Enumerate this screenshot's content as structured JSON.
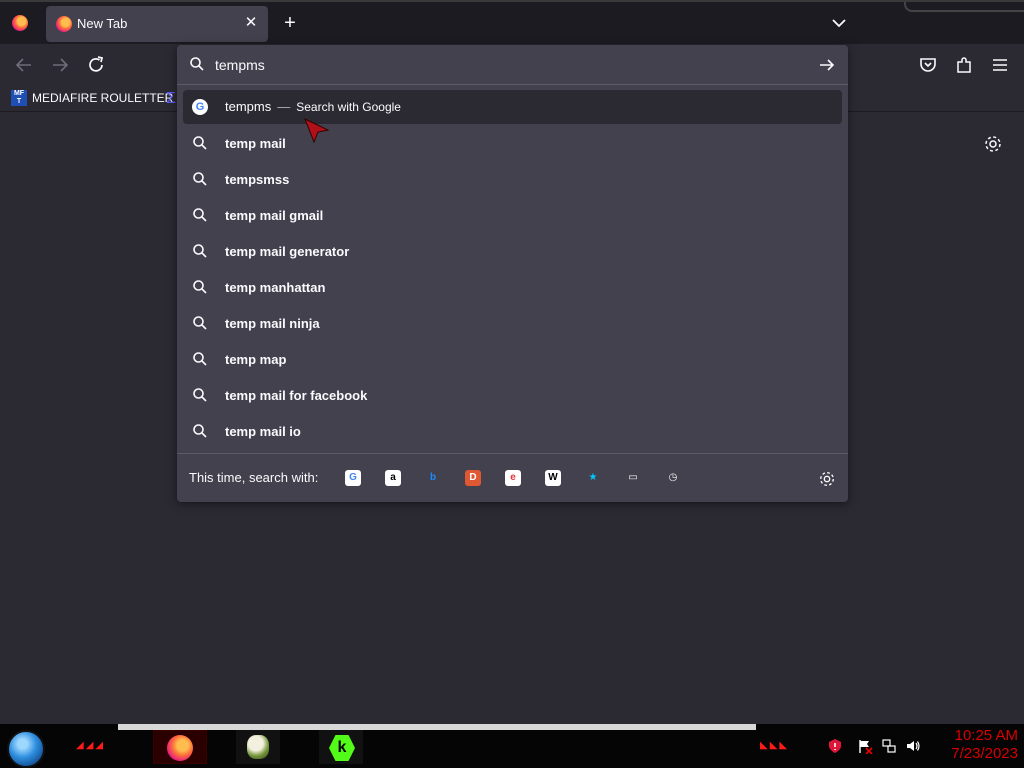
{
  "browser": {
    "tab": {
      "title": "New Tab",
      "close_glyph": "✕"
    },
    "new_tab_glyph": "+",
    "bookmarks": [
      {
        "icon_text": "MF\nT",
        "label": "MEDIAFIRE ROULETTER"
      }
    ]
  },
  "urlbar": {
    "value": "tempms",
    "results": [
      {
        "type": "search-action",
        "query": "tempms",
        "separator": "—",
        "action": "Search with Google",
        "icon": "google-icon",
        "selected": true
      },
      {
        "type": "suggestion",
        "text": "temp mail",
        "icon": "search-icon"
      },
      {
        "type": "suggestion",
        "text": "tempsmss",
        "icon": "search-icon"
      },
      {
        "type": "suggestion",
        "text": "temp mail gmail",
        "icon": "search-icon"
      },
      {
        "type": "suggestion",
        "text": "temp mail generator",
        "icon": "search-icon"
      },
      {
        "type": "suggestion",
        "text": "temp manhattan",
        "icon": "search-icon"
      },
      {
        "type": "suggestion",
        "text": "temp mail ninja",
        "icon": "search-icon"
      },
      {
        "type": "suggestion",
        "text": "temp map",
        "icon": "search-icon"
      },
      {
        "type": "suggestion",
        "text": "temp mail for facebook",
        "icon": "search-icon"
      },
      {
        "type": "suggestion",
        "text": "temp mail io",
        "icon": "search-icon"
      }
    ],
    "footer": {
      "label": "This time, search with:",
      "engines": [
        {
          "name": "google-icon",
          "glyph": "G",
          "color": "#4285f4",
          "bg": "#ffffff"
        },
        {
          "name": "amazon-icon",
          "glyph": "a",
          "color": "#000000",
          "bg": "#ffffff"
        },
        {
          "name": "bing-icon",
          "glyph": "b",
          "color": "#1a8cff",
          "bg": "transparent"
        },
        {
          "name": "duckduckgo-icon",
          "glyph": "D",
          "color": "#ffffff",
          "bg": "#de5833"
        },
        {
          "name": "ebay-icon",
          "glyph": "e",
          "color": "#e53238",
          "bg": "#ffffff"
        },
        {
          "name": "wikipedia-icon",
          "glyph": "W",
          "color": "#000000",
          "bg": "#ffffff"
        },
        {
          "name": "bookmarks-star-icon",
          "glyph": "★",
          "color": "#00c8ff",
          "bg": "transparent"
        },
        {
          "name": "tabs-icon",
          "glyph": "▭",
          "color": "#fbfbfe",
          "bg": "transparent"
        },
        {
          "name": "history-icon",
          "glyph": "◷",
          "color": "#fbfbfe",
          "bg": "transparent"
        }
      ]
    }
  },
  "taskbar": {
    "clock_time": "10:25 AM",
    "clock_date": "7/23/2023"
  },
  "colors": {
    "toolbar": "#2b2a33",
    "tabstrip": "#1c1b22",
    "panel": "#42414d",
    "text": "#fbfbfe",
    "clock": "#d80000"
  }
}
